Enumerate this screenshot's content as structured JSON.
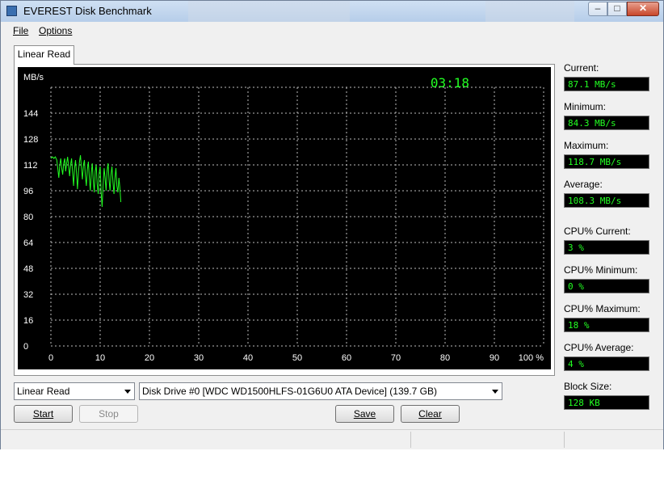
{
  "window": {
    "title": "EVEREST Disk Benchmark",
    "controls": {
      "minimize": "–",
      "maximize": "□",
      "close": "✕"
    }
  },
  "menu": {
    "file": "File",
    "options": "Options"
  },
  "tab": {
    "label": "Linear Read"
  },
  "chart_data": {
    "type": "line",
    "ylabel": "MB/s",
    "y_ticks": [
      0,
      16,
      32,
      48,
      64,
      80,
      96,
      112,
      128,
      144
    ],
    "x_ticks": [
      "0",
      "10",
      "20",
      "30",
      "40",
      "50",
      "60",
      "70",
      "80",
      "90"
    ],
    "x_unit": "100 %",
    "xlim": [
      0,
      100
    ],
    "ylim": [
      0,
      160
    ],
    "grid": true,
    "timer": "03:18",
    "line_color": "#22ff22",
    "series": [
      {
        "values": [
          [
            0,
            116
          ],
          [
            0.3,
            117
          ],
          [
            0.6,
            116
          ],
          [
            0.9,
            117
          ],
          [
            1.2,
            115
          ],
          [
            1.4,
            110
          ],
          [
            1.6,
            104
          ],
          [
            1.8,
            112
          ],
          [
            2.0,
            116
          ],
          [
            2.2,
            110
          ],
          [
            2.4,
            106
          ],
          [
            2.6,
            113
          ],
          [
            2.8,
            116
          ],
          [
            3.0,
            108
          ],
          [
            3.2,
            113
          ],
          [
            3.4,
            117
          ],
          [
            3.6,
            111
          ],
          [
            3.8,
            105
          ],
          [
            4.0,
            112
          ],
          [
            4.2,
            116
          ],
          [
            4.4,
            108
          ],
          [
            4.6,
            99
          ],
          [
            4.8,
            110
          ],
          [
            5.0,
            115
          ],
          [
            5.2,
            107
          ],
          [
            5.4,
            97
          ],
          [
            5.6,
            108
          ],
          [
            5.8,
            114
          ],
          [
            6.0,
            118
          ],
          [
            6.2,
            110
          ],
          [
            6.4,
            103
          ],
          [
            6.6,
            112
          ],
          [
            6.8,
            115
          ],
          [
            7.0,
            105
          ],
          [
            7.2,
            99
          ],
          [
            7.4,
            109
          ],
          [
            7.6,
            114
          ],
          [
            7.8,
            104
          ],
          [
            8.0,
            96
          ],
          [
            8.2,
            107
          ],
          [
            8.4,
            113
          ],
          [
            8.6,
            102
          ],
          [
            8.8,
            95
          ],
          [
            9.0,
            108
          ],
          [
            9.2,
            112
          ],
          [
            9.4,
            100
          ],
          [
            9.6,
            94
          ],
          [
            9.8,
            107
          ],
          [
            10.0,
            111
          ],
          [
            10.2,
            95
          ],
          [
            10.4,
            86
          ],
          [
            10.6,
            100
          ],
          [
            10.8,
            110
          ],
          [
            11.0,
            104
          ],
          [
            11.2,
            96
          ],
          [
            11.4,
            108
          ],
          [
            11.6,
            113
          ],
          [
            11.8,
            103
          ],
          [
            12.0,
            96
          ],
          [
            12.2,
            106
          ],
          [
            12.4,
            111
          ],
          [
            12.6,
            101
          ],
          [
            12.8,
            94
          ],
          [
            13.0,
            104
          ],
          [
            13.2,
            110
          ],
          [
            13.4,
            99
          ],
          [
            13.6,
            95
          ],
          [
            13.8,
            104
          ],
          [
            14.0,
            98
          ],
          [
            14.2,
            89
          ]
        ]
      }
    ]
  },
  "stats": [
    {
      "label": "Current:",
      "value": "87.1 MB/s"
    },
    {
      "label": "Minimum:",
      "value": "84.3 MB/s"
    },
    {
      "label": "Maximum:",
      "value": "118.7 MB/s"
    },
    {
      "label": "Average:",
      "value": "108.3 MB/s"
    },
    {
      "label": "CPU% Current:",
      "value": "3 %"
    },
    {
      "label": "CPU% Minimum:",
      "value": "0 %"
    },
    {
      "label": "CPU% Maximum:",
      "value": "18 %"
    },
    {
      "label": "CPU% Average:",
      "value": "4 %"
    },
    {
      "label": "Block Size:",
      "value": "128 KB"
    }
  ],
  "controls": {
    "test_select": "Linear Read",
    "drive_select": "Disk Drive #0  [WDC WD1500HLFS-01G6U0 ATA Device]  (139.7 GB)",
    "start": "Start",
    "stop": "Stop",
    "save": "Save",
    "clear": "Clear"
  }
}
